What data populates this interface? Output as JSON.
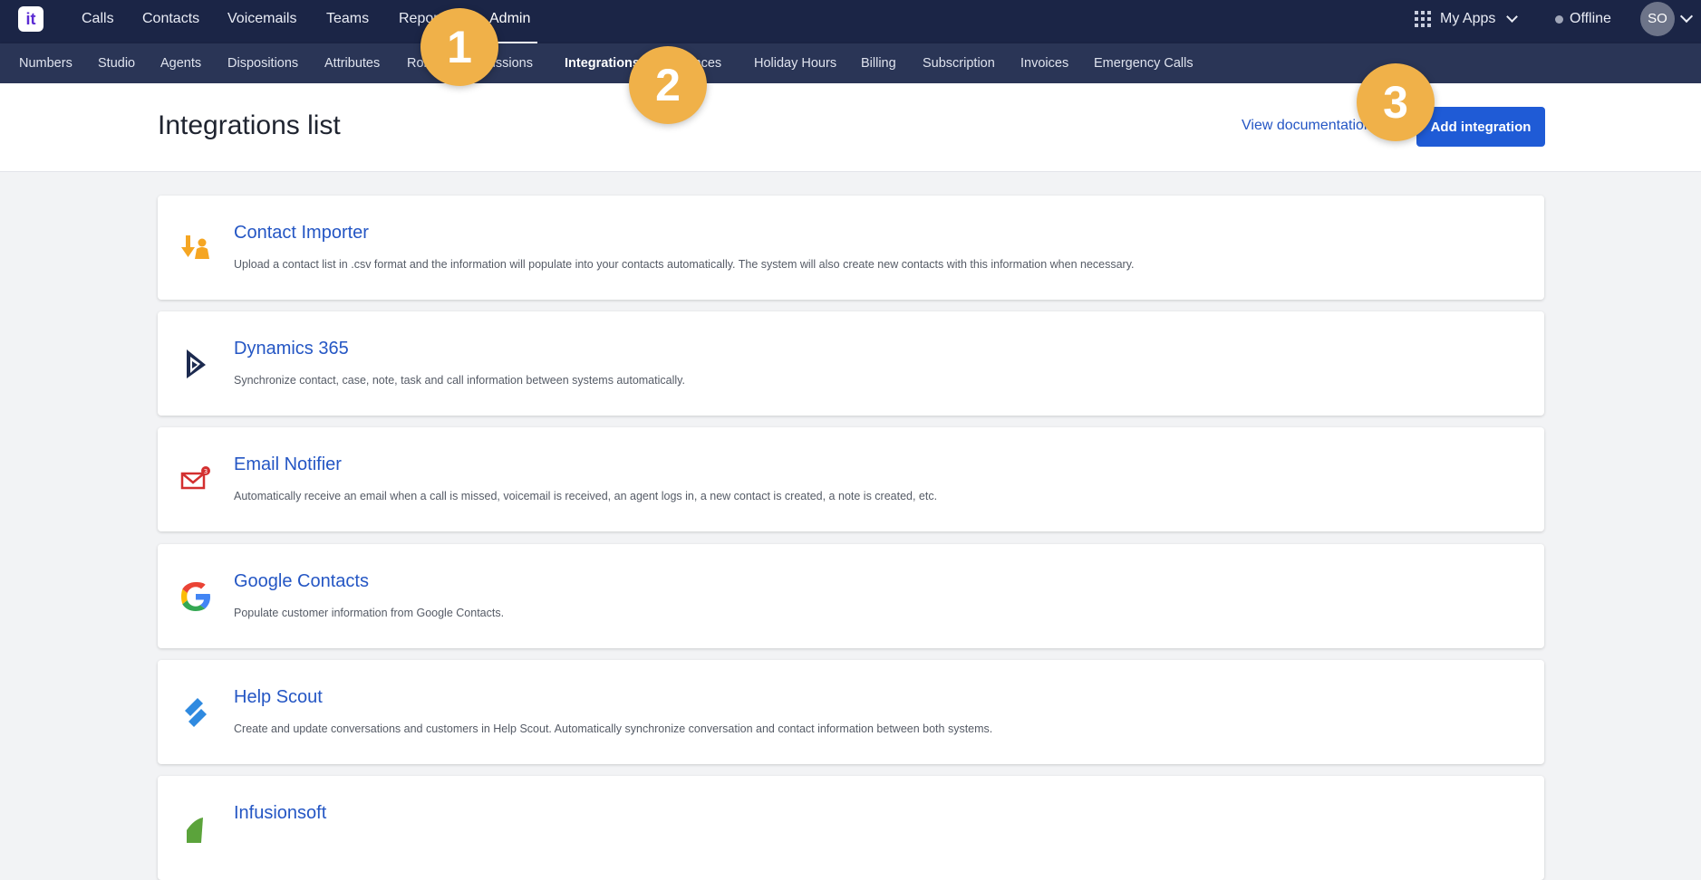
{
  "topnav": {
    "logo": "it",
    "items": [
      {
        "label": "Calls"
      },
      {
        "label": "Contacts"
      },
      {
        "label": "Voicemails"
      },
      {
        "label": "Teams"
      },
      {
        "label": "Reports"
      },
      {
        "label": "Admin",
        "active": true
      }
    ],
    "my_apps": "My Apps",
    "status": "Offline",
    "avatar": "SO"
  },
  "subnav": {
    "items": [
      {
        "label": "Numbers"
      },
      {
        "label": "Studio"
      },
      {
        "label": "Agents"
      },
      {
        "label": "Dispositions"
      },
      {
        "label": "Attributes"
      },
      {
        "label": "Roles"
      },
      {
        "label": "Permissions"
      },
      {
        "label": "Integrations",
        "active": true
      },
      {
        "label": "Preferences"
      },
      {
        "label": "Holiday Hours"
      },
      {
        "label": "Billing"
      },
      {
        "label": "Subscription"
      },
      {
        "label": "Invoices"
      },
      {
        "label": "Emergency Calls"
      }
    ]
  },
  "header": {
    "title": "Integrations list",
    "doc_link": "View documentation",
    "add_button": "Add integration"
  },
  "integrations": [
    {
      "name": "Contact Importer",
      "icon": "contact-importer-icon",
      "description": "Upload a contact list in .csv format and the information will populate into your contacts automatically. The system will also create new contacts with this information when necessary."
    },
    {
      "name": "Dynamics 365",
      "icon": "dynamics-365-icon",
      "description": "Synchronize contact, case, note, task and call information between systems automatically."
    },
    {
      "name": "Email Notifier",
      "icon": "email-notifier-icon",
      "description": "Automatically receive an email when a call is missed, voicemail is received, an agent logs in, a new contact is created, a note is created, etc."
    },
    {
      "name": "Google Contacts",
      "icon": "google-icon",
      "description": "Populate customer information from Google Contacts."
    },
    {
      "name": "Help Scout",
      "icon": "help-scout-icon",
      "description": "Create and update conversations and customers in Help Scout. Automatically synchronize conversation and contact information between both systems."
    },
    {
      "name": "Infusionsoft",
      "icon": "infusionsoft-icon",
      "description": ""
    }
  ],
  "steps": [
    "1",
    "2",
    "3"
  ],
  "colors": {
    "topbar": "#1b2546",
    "subbar": "#2a3556",
    "accent": "#1f5bd6",
    "step_badge": "#f0b149"
  }
}
